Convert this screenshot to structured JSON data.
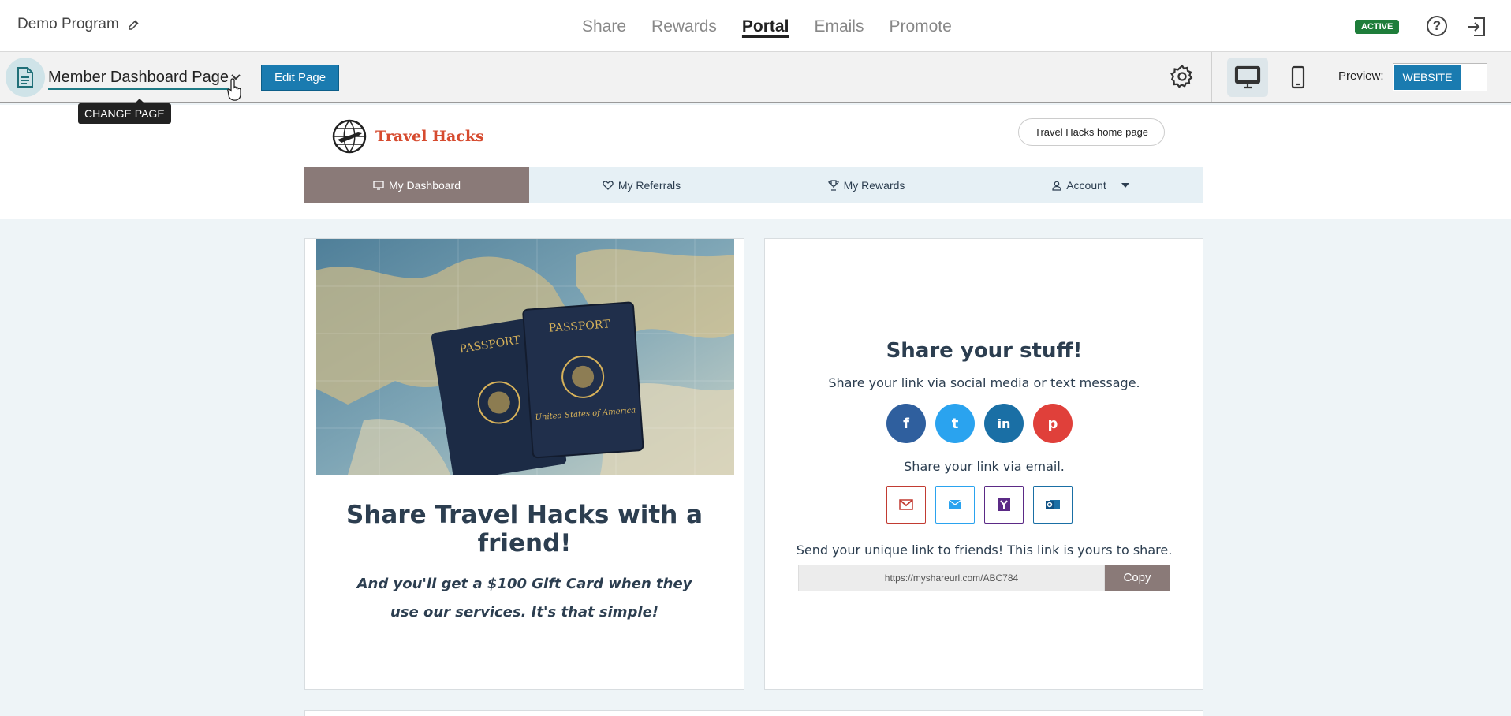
{
  "top": {
    "program_name": "Demo Program",
    "nav": [
      "Share",
      "Rewards",
      "Portal",
      "Emails",
      "Promote"
    ],
    "active_nav": "Portal",
    "status_badge": "ACTIVE",
    "help_symbol": "?"
  },
  "editor": {
    "page_name": "Member Dashboard Page",
    "edit_label": "Edit Page",
    "tooltip": "CHANGE PAGE",
    "preview_label": "Preview:",
    "preview_mode": "WEBSITE"
  },
  "portal": {
    "brand": "Travel Hacks",
    "home_button": "Travel Hacks home page",
    "tabs": {
      "dashboard": "My Dashboard",
      "referrals": "My Referrals",
      "rewards": "My Rewards",
      "account": "Account"
    }
  },
  "left_card": {
    "passport_word": "PASSPORT",
    "passport_subtitle": "United States of America",
    "title": "Share Travel Hacks with a friend!",
    "subtitle": "And you'll get a $100 Gift Card when they use our services. It's that simple!"
  },
  "right_card": {
    "title": "Share your stuff!",
    "social_text": "Share your link via social media or text message.",
    "social_icons": [
      {
        "name": "facebook",
        "glyph": "f",
        "color": "#2f5f9e"
      },
      {
        "name": "twitter",
        "glyph": "t",
        "color": "#2aa3ef"
      },
      {
        "name": "linkedin",
        "glyph": "in",
        "color": "#1a6fa5"
      },
      {
        "name": "pinterest",
        "glyph": "p",
        "color": "#e0403a"
      }
    ],
    "email_text": "Share your link via email.",
    "link_text": "Send your unique link to friends! This link is yours to share.",
    "share_url": "https://myshareurl.com/ABC784",
    "copy_label": "Copy"
  },
  "colors": {
    "accent": "#1a7bb0",
    "active_tab": "#8a7a78",
    "brand": "#d64b2f"
  }
}
